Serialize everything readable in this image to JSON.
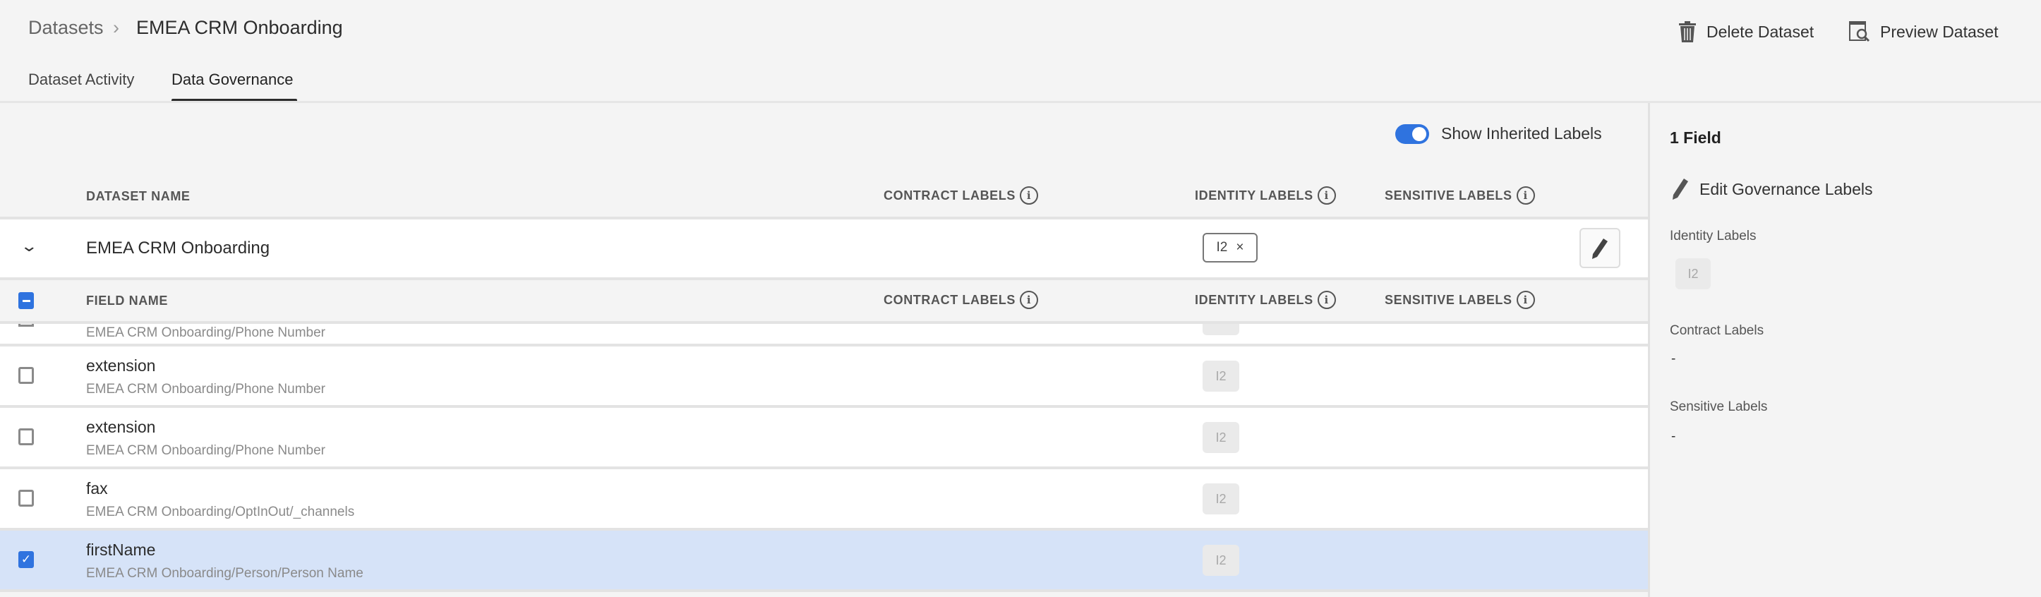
{
  "breadcrumb": {
    "parent": "Datasets",
    "current": "EMEA CRM Onboarding"
  },
  "actions": {
    "delete": "Delete Dataset",
    "preview": "Preview Dataset"
  },
  "tabs": [
    {
      "label": "Dataset Activity"
    },
    {
      "label": "Data Governance",
      "active": true
    }
  ],
  "toggle": {
    "label": "Show Inherited Labels",
    "on": true
  },
  "dataset_table": {
    "headers": {
      "name": "DATASET NAME",
      "contract": "CONTRACT LABELS",
      "identity": "IDENTITY LABELS",
      "sensitive": "SENSITIVE LABELS"
    },
    "row": {
      "name": "EMEA CRM Onboarding",
      "identity_label": "I2",
      "remove": "×"
    }
  },
  "field_table": {
    "headers": {
      "name": "FIELD NAME",
      "contract": "CONTRACT LABELS",
      "identity": "IDENTITY LABELS",
      "sensitive": "SENSITIVE LABELS"
    },
    "partial_row": {
      "path": "EMEA CRM Onboarding/Phone Number"
    },
    "rows": [
      {
        "name": "extension",
        "path": "EMEA CRM Onboarding/Phone Number",
        "identity": "I2",
        "checked": false
      },
      {
        "name": "extension",
        "path": "EMEA CRM Onboarding/Phone Number",
        "identity": "I2",
        "checked": false
      },
      {
        "name": "fax",
        "path": "EMEA CRM Onboarding/OptInOut/_channels",
        "identity": "I2",
        "checked": false
      },
      {
        "name": "firstName",
        "path": "EMEA CRM Onboarding/Person/Person Name",
        "identity": "I2",
        "checked": true
      }
    ]
  },
  "sidebar": {
    "count": "1 Field",
    "edit": "Edit Governance Labels",
    "identity_title": "Identity Labels",
    "identity_value": "I2",
    "contract_title": "Contract Labels",
    "contract_value": "-",
    "sensitive_title": "Sensitive Labels",
    "sensitive_value": "-"
  },
  "colors": {
    "accent": "#2f73df",
    "selected_row": "#d6e3f8"
  }
}
